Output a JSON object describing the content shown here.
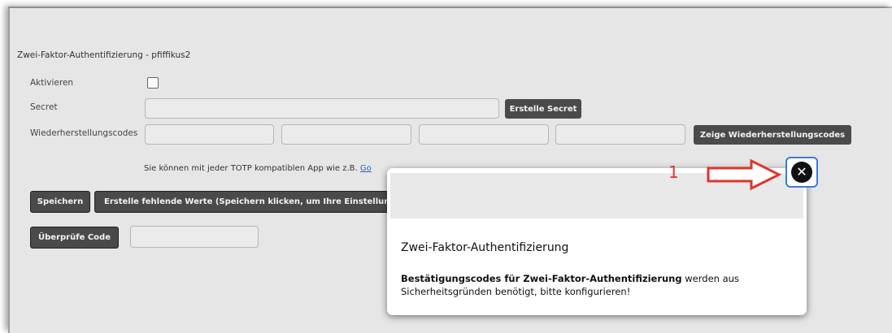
{
  "form": {
    "title": "Zwei-Faktor-Authentifizierung - pfiffikus2",
    "activate_label": "Aktivieren",
    "secret_label": "Secret",
    "create_secret_button": "Erstelle Secret",
    "recovery_label": "Wiederherstellungscodes",
    "show_recovery_button": "Zeige Wiederherstellungscodes",
    "info_text_start": "Sie können mit jeder TOTP kompatiblen App wie z.B. ",
    "info_link": "Go",
    "save_button": "Speichern",
    "create_missing_button": "Erstelle fehlende Werte (Speichern klicken, um Ihre Einstellungen",
    "check_code_button": "Überprüfe Code"
  },
  "popup": {
    "title": "Zwei-Faktor-Authentifizierung",
    "body_bold": "Bestätigungscodes für Zwei-Faktor-Authentifizierung",
    "body_rest": " werden aus Sicherheitsgründen benötigt, bitte konfigurieren!"
  },
  "annotation": {
    "number": "1",
    "color": "#e0352b"
  },
  "icons": {
    "close": "close-circle-icon",
    "arrow": "arrow-right-icon"
  }
}
